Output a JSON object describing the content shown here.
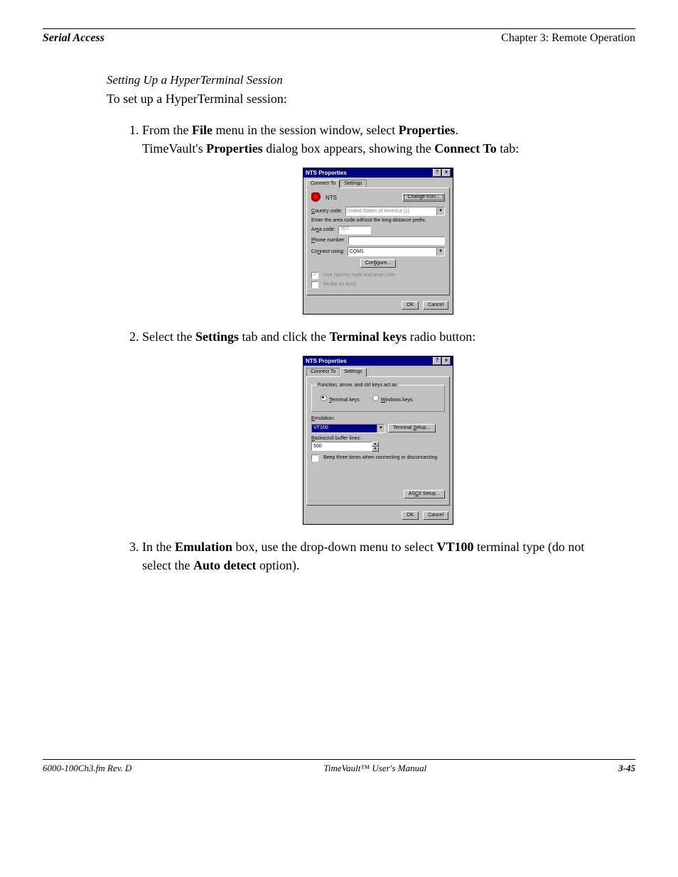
{
  "header": {
    "left": "Serial Access",
    "right": "Chapter 3: Remote Operation"
  },
  "section": {
    "subheading": "Setting Up a HyperTerminal Session",
    "intro": "To set up a HyperTerminal session:"
  },
  "steps": {
    "s1a": "From the ",
    "s1b": "File",
    "s1c": " menu in the session window, select ",
    "s1d": "Properties",
    "s1e": ".",
    "s1f": "TimeVault's ",
    "s1g": "Properties",
    "s1h": " dialog box appears, showing the ",
    "s1i": "Connect To",
    "s1j": " tab:",
    "s2a": "Select the ",
    "s2b": "Settings",
    "s2c": " tab and click the ",
    "s2d": "Terminal keys",
    "s2e": " radio button:",
    "s3a": "In the ",
    "s3b": "Emulation",
    "s3c": " box, use the drop-down menu to select ",
    "s3d": "VT100",
    "s3e": " terminal type (do not select the ",
    "s3f": "Auto detect",
    "s3g": " option)."
  },
  "dialog1": {
    "title": "NTS Properties",
    "tab_connect": "Connect To",
    "tab_settings": "Settings",
    "icon_label": "NTS",
    "change_icon": "Change Icon...",
    "country_label": "Country code:",
    "country_value": "United States of America (1)",
    "hint": "Enter the area code without the long-distance prefix.",
    "area_label": "Area code:",
    "area_value": "707",
    "phone_label": "Phone number:",
    "connect_label": "Connect using:",
    "connect_value": "COM1",
    "configure": "Configure...",
    "chk1": "Use country code and area code",
    "chk2": "Redial on busy",
    "ok": "OK",
    "cancel": "Cancel"
  },
  "dialog2": {
    "title": "NTS Properties",
    "tab_connect": "Connect To",
    "tab_settings": "Settings",
    "legend": "Function, arrow, and ctrl keys act as",
    "radio_terminal": "Terminal keys",
    "radio_windows": "Windows keys",
    "emulation": "Emulation:",
    "emulation_value": "VT100",
    "terminal_setup": "Terminal Setup...",
    "backscroll": "Backscroll buffer lines:",
    "backscroll_value": "500",
    "beep": "Beep three times when connecting or disconnecting",
    "ascii_setup": "ASCII Setup...",
    "ok": "OK",
    "cancel": "Cancel"
  },
  "footer": {
    "left": "6000-100Ch3.fm  Rev. D",
    "center": "TimeVault™ User's Manual",
    "right": "3-45"
  }
}
